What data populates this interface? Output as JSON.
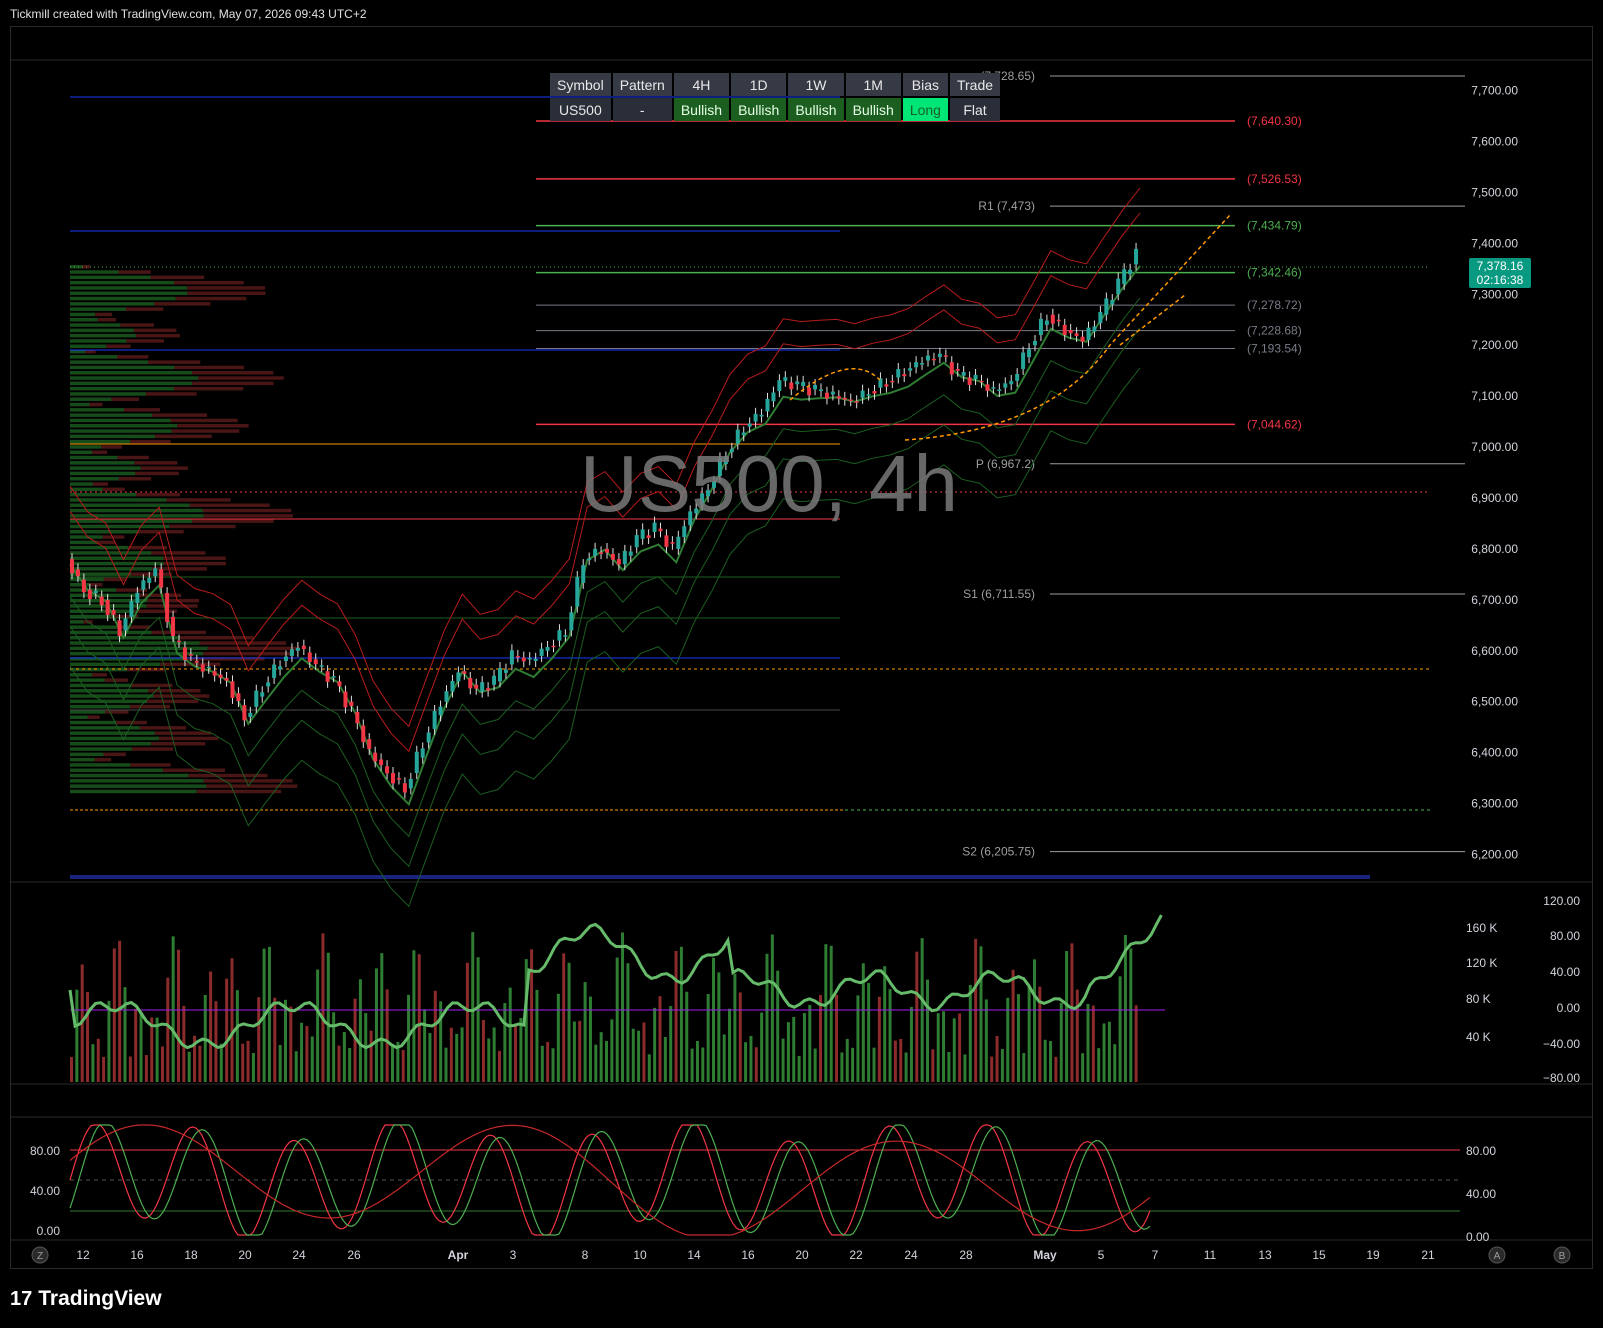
{
  "header": {
    "text": "Tickmill created with TradingView.com, May 07, 2026 09:43 UTC+2"
  },
  "footer": {
    "brand": "TradingView",
    "logo_glyph": "17"
  },
  "watermark": {
    "text": "US500, 4h"
  },
  "signal_table": {
    "headers": [
      "Symbol",
      "Pattern",
      "4H",
      "1D",
      "1W",
      "1M",
      "Bias",
      "Trade"
    ],
    "row": [
      "US500",
      "-",
      "Bullish",
      "Bullish",
      "Bullish",
      "Bullish",
      "Long",
      "Flat"
    ]
  },
  "colors": {
    "bull": "#26a69a",
    "bear": "#ef5350",
    "green_line": "#4caf50",
    "red_line": "#f23645",
    "orange": "#ff9800",
    "blue": "#2962ff",
    "badge_green": "#089981"
  },
  "chart_data": {
    "type": "candlestick",
    "symbol": "US500",
    "timeframe": "4h",
    "last_price": {
      "value": "7,378.16",
      "countdown": "02:16:38"
    },
    "y_axis_ticks": [
      "7,700.00",
      "7,600.00",
      "7,500.00",
      "7,400.00",
      "7,300.00",
      "7,200.00",
      "7,100.00",
      "7,000.00",
      "6,900.00",
      "6,800.00",
      "6,700.00",
      "6,600.00",
      "6,500.00",
      "6,400.00",
      "6,300.00",
      "6,200.00"
    ],
    "y_range": [
      6150,
      7760
    ],
    "x_axis_ticks": [
      "12",
      "16",
      "18",
      "20",
      "24",
      "26",
      "Apr",
      "3",
      "8",
      "10",
      "14",
      "16",
      "20",
      "22",
      "24",
      "28",
      "May",
      "5",
      "7",
      "11",
      "13",
      "15",
      "19",
      "21"
    ],
    "price_path": [
      [
        0,
        6780
      ],
      [
        4,
        6720
      ],
      [
        8,
        6700
      ],
      [
        12,
        6640
      ],
      [
        16,
        6720
      ],
      [
        20,
        6760
      ],
      [
        24,
        6620
      ],
      [
        28,
        6580
      ],
      [
        32,
        6560
      ],
      [
        36,
        6540
      ],
      [
        40,
        6470
      ],
      [
        44,
        6530
      ],
      [
        48,
        6580
      ],
      [
        52,
        6610
      ],
      [
        56,
        6570
      ],
      [
        60,
        6540
      ],
      [
        64,
        6480
      ],
      [
        68,
        6400
      ],
      [
        72,
        6360
      ],
      [
        76,
        6330
      ],
      [
        80,
        6420
      ],
      [
        84,
        6500
      ],
      [
        88,
        6560
      ],
      [
        92,
        6520
      ],
      [
        96,
        6540
      ],
      [
        100,
        6590
      ],
      [
        104,
        6580
      ],
      [
        108,
        6610
      ],
      [
        112,
        6640
      ],
      [
        116,
        6780
      ],
      [
        120,
        6800
      ],
      [
        124,
        6770
      ],
      [
        128,
        6820
      ],
      [
        132,
        6840
      ],
      [
        136,
        6800
      ],
      [
        140,
        6870
      ],
      [
        144,
        6920
      ],
      [
        148,
        6990
      ],
      [
        152,
        7040
      ],
      [
        156,
        7070
      ],
      [
        160,
        7130
      ],
      [
        164,
        7120
      ],
      [
        168,
        7110
      ],
      [
        172,
        7100
      ],
      [
        176,
        7090
      ],
      [
        180,
        7110
      ],
      [
        184,
        7130
      ],
      [
        188,
        7150
      ],
      [
        192,
        7170
      ],
      [
        196,
        7180
      ],
      [
        200,
        7140
      ],
      [
        204,
        7130
      ],
      [
        208,
        7110
      ],
      [
        212,
        7130
      ],
      [
        216,
        7200
      ],
      [
        220,
        7260
      ],
      [
        224,
        7230
      ],
      [
        228,
        7210
      ],
      [
        232,
        7260
      ],
      [
        236,
        7320
      ],
      [
        240,
        7378
      ]
    ],
    "levels": [
      {
        "label": "(7,728.65)",
        "price": 7728.65,
        "color": "#9e9e9e"
      },
      {
        "label": "(7,640.30)",
        "price": 7640.3,
        "color": "#f23645"
      },
      {
        "label": "(7,526.53)",
        "price": 7526.53,
        "color": "#f23645"
      },
      {
        "label": "R1 (7,473)",
        "price": 7473,
        "color": "#9e9e9e"
      },
      {
        "label": "(7,434.79)",
        "price": 7434.79,
        "color": "#4caf50"
      },
      {
        "label": "(7,342.46)",
        "price": 7342.46,
        "color": "#4caf50"
      },
      {
        "label": "(7,278.72)",
        "price": 7278.72,
        "color": "#787b86"
      },
      {
        "label": "(7,228.68)",
        "price": 7228.68,
        "color": "#787b86"
      },
      {
        "label": "(7,193.54)",
        "price": 7193.54,
        "color": "#787b86"
      },
      {
        "label": "(7,044.62)",
        "price": 7044.62,
        "color": "#f23645"
      },
      {
        "label": "P (6,967.2)",
        "price": 6967.2,
        "color": "#9e9e9e"
      },
      {
        "label": "S1 (6,711.55)",
        "price": 6711.55,
        "color": "#9e9e9e"
      },
      {
        "label": "S2 (6,205.75)",
        "price": 6205.75,
        "color": "#9e9e9e"
      }
    ],
    "volume_axis_ticks": [
      "160 K",
      "120 K",
      "80 K",
      "40 K"
    ],
    "oscillator_axis_ticks": [
      "120.00",
      "80.00",
      "40.00",
      "0.00",
      "−40.00",
      "−80.00"
    ],
    "stoch_left_ticks": [
      "80.00",
      "40.00",
      "0.00"
    ],
    "stoch_right_ticks": [
      "80.00",
      "40.00",
      "0.00"
    ],
    "bottom_buttons": [
      "Z",
      "A",
      "B"
    ]
  }
}
